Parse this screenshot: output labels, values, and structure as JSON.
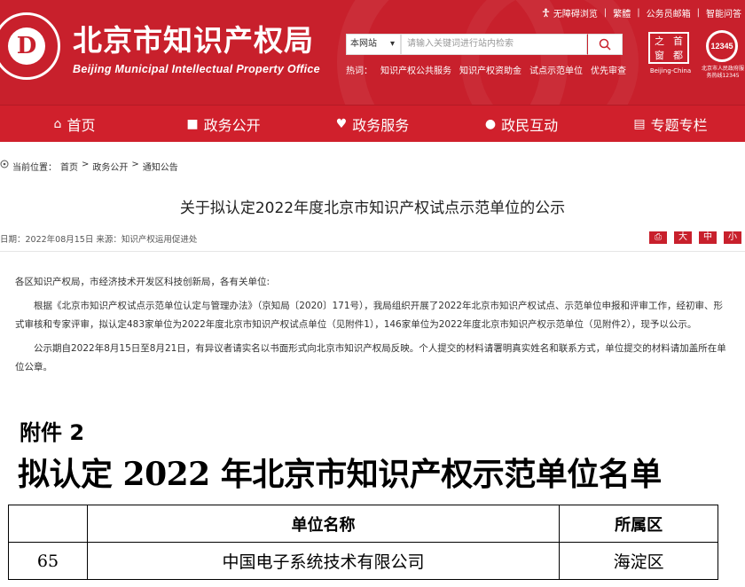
{
  "header": {
    "title": "北京市知识产权局",
    "subtitle": "Beijing Municipal Intellectual Property Office",
    "emblem_letter": "D",
    "toplinks": [
      "无障碍浏览",
      "繁體",
      "公务员邮箱",
      "智能问答"
    ],
    "search": {
      "scope": "本网站",
      "placeholder": "请输入关键词进行站内检索"
    },
    "hotwords_label": "热词：",
    "hotwords": [
      "知识产权公共服务",
      "知识产权资助金",
      "试点示范单位",
      "优先审查"
    ],
    "seal_chars": [
      "之",
      "首",
      "窗",
      "都"
    ],
    "seal_caption": "Beijing-China",
    "hotline_number": "12345",
    "hotline_caption": "北京市人民政府服务热线12345"
  },
  "nav": [
    {
      "label": "首页",
      "icon": "home-icon"
    },
    {
      "label": "政务公开",
      "icon": "briefcase-icon"
    },
    {
      "label": "政务服务",
      "icon": "hand-icon"
    },
    {
      "label": "政民互动",
      "icon": "chat-icon"
    },
    {
      "label": "专题专栏",
      "icon": "document-icon"
    }
  ],
  "breadcrumb": {
    "label": "当前位置：",
    "items": [
      "首页",
      "政务公开",
      "通知公告"
    ],
    "sep": ">"
  },
  "article": {
    "title": "关于拟认定2022年度北京市知识产权试点示范单位的公示",
    "meta": "日期：2022年08月15日  来源：知识产权运用促进处",
    "font_sizes": [
      "大",
      "中",
      "小"
    ],
    "salutation": "各区知识产权局，市经济技术开发区科技创新局，各有关单位:",
    "para1": "根据《北京市知识产权试点示范单位认定与管理办法》（京知局〔2020〕171号），我局组织开展了2022年北京市知识产权试点、示范单位申报和评审工作，经初审、形式审核和专家评审，拟认定483家单位为2022年度北京市知识产权试点单位（见附件1），146家单位为2022年度北京市知识产权示范单位（见附件2），现予以公示。",
    "para2": "公示期自2022年8月15日至8月21日，有异议者请实名以书面形式向北京市知识产权局反映。个人提交的材料请署明真实姓名和联系方式，单位提交的材料请加盖所在单位公章。"
  },
  "attachment": {
    "label": "附件 2",
    "title": "拟认定 2022 年北京市知识产权示范单位名单",
    "columns": [
      "",
      "单位名称",
      "所属区"
    ],
    "rows": [
      {
        "no": "65",
        "name": "中国电子系统技术有限公司",
        "district": "海淀区"
      }
    ]
  },
  "colors": {
    "brand_red": "#c8202c",
    "text": "#333333"
  }
}
